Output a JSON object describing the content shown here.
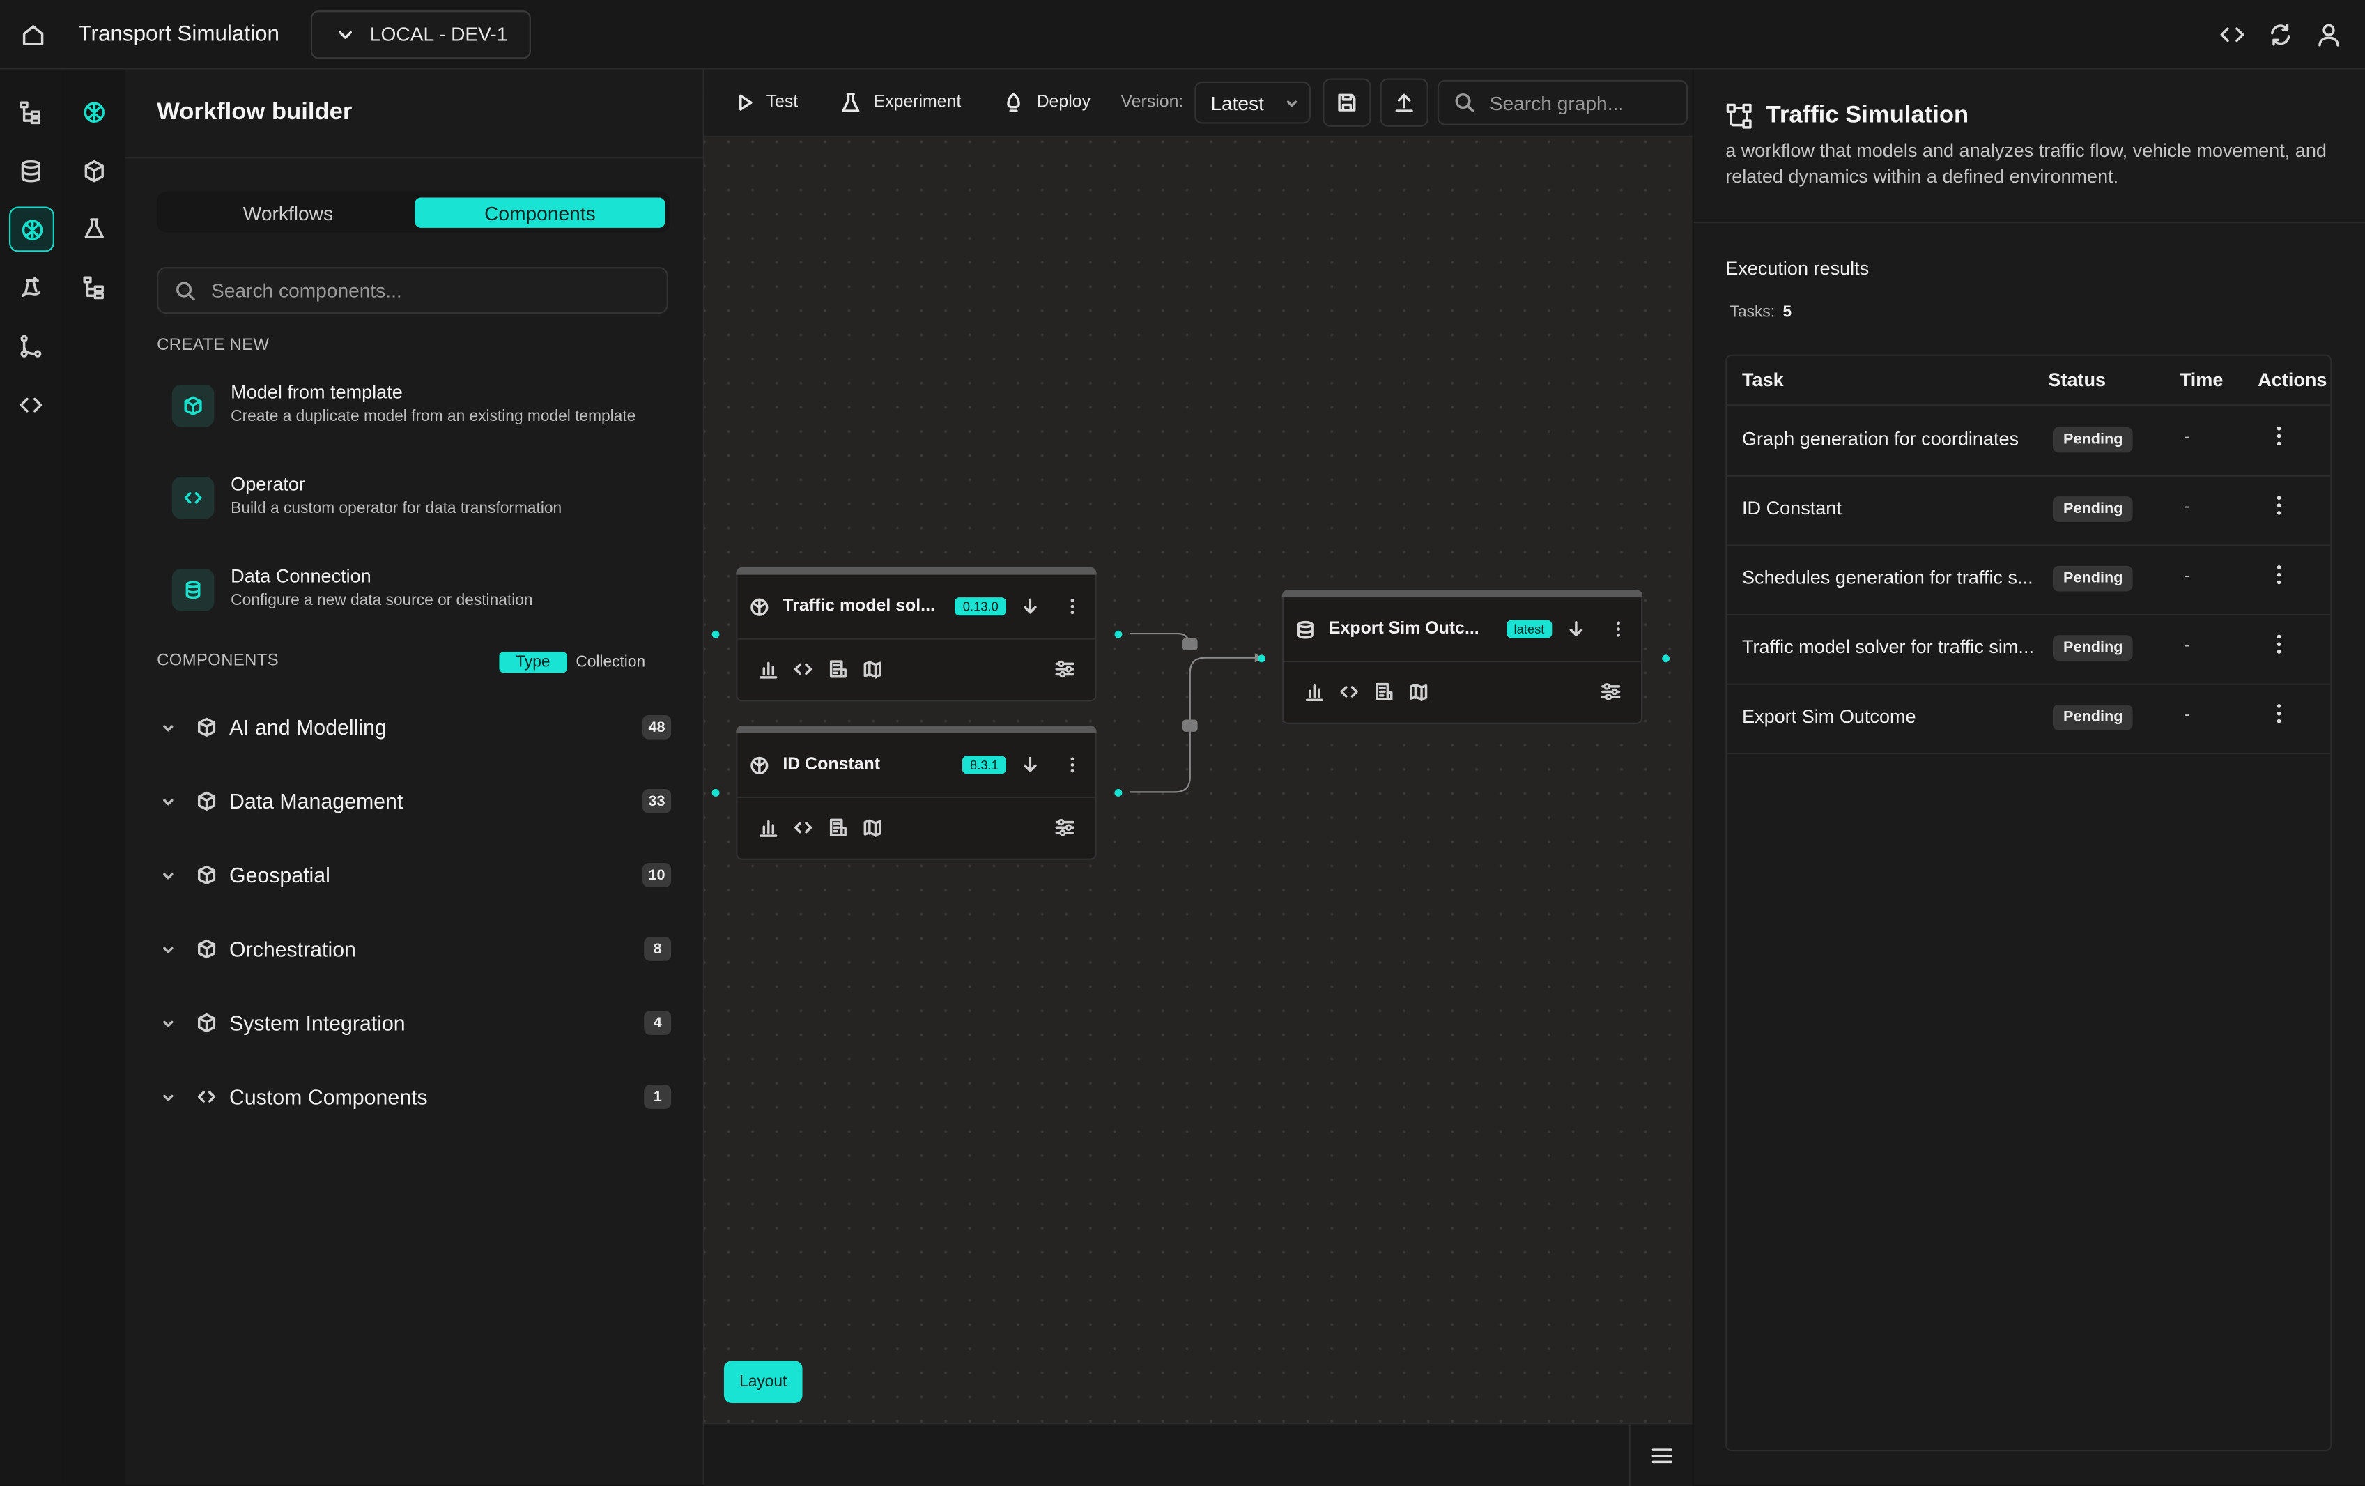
{
  "app": {
    "title": "Transport Simulation",
    "environment": "LOCAL - DEV-1"
  },
  "left_panel": {
    "title": "Workflow builder",
    "tabs": [
      "Workflows",
      "Components"
    ],
    "active_tab": "Components",
    "search_placeholder": "Search components...",
    "create_new_label": "CREATE NEW",
    "create_items": [
      {
        "title": "Model from template",
        "desc": "Create a duplicate model from an existing model template",
        "icon": "cube-icon"
      },
      {
        "title": "Operator",
        "desc": "Build a custom operator for data transformation",
        "icon": "code-icon"
      },
      {
        "title": "Data Connection",
        "desc": "Configure a new data source or destination",
        "icon": "database-icon"
      }
    ],
    "components_label": "COMPONENTS",
    "view_toggle": [
      "Type",
      "Collection"
    ],
    "active_view": "Type",
    "categories": [
      {
        "label": "AI and Modelling",
        "count": "48"
      },
      {
        "label": "Data Management",
        "count": "33"
      },
      {
        "label": "Geospatial",
        "count": "10"
      },
      {
        "label": "Orchestration",
        "count": "8"
      },
      {
        "label": "System Integration",
        "count": "4"
      },
      {
        "label": "Custom Components",
        "count": "1"
      }
    ]
  },
  "toolbar": {
    "test": "Test",
    "experiment": "Experiment",
    "deploy": "Deploy",
    "version_label": "Version:",
    "version_value": "Latest",
    "search_placeholder": "Search graph..."
  },
  "nodes": [
    {
      "title": "Traffic model sol...",
      "version": "0.13.0",
      "icon": "brain-icon"
    },
    {
      "title": "ID Constant",
      "version": "8.3.1",
      "icon": "brain-icon"
    },
    {
      "title": "Export Sim Outc...",
      "version": "latest",
      "icon": "database-icon"
    }
  ],
  "canvas": {
    "layout_button": "Layout"
  },
  "right_panel": {
    "title": "Traffic Simulation",
    "description": "a workflow that models and analyzes traffic flow, vehicle movement, and related dynamics within a defined environment.",
    "execution_heading": "Execution results",
    "tasks_label": "Tasks:",
    "tasks_count": "5",
    "columns": [
      "Task",
      "Status",
      "Time",
      "Actions"
    ],
    "rows": [
      {
        "task": "Graph generation for coordinates",
        "status": "Pending",
        "time": "-"
      },
      {
        "task": "ID Constant",
        "status": "Pending",
        "time": "-"
      },
      {
        "task": "Schedules generation for traffic s...",
        "status": "Pending",
        "time": "-"
      },
      {
        "task": "Traffic model solver for traffic sim...",
        "status": "Pending",
        "time": "-"
      },
      {
        "task": "Export Sim Outcome",
        "status": "Pending",
        "time": "-"
      }
    ]
  },
  "colors": {
    "accent": "#19e4d3",
    "background": "#141414",
    "panel": "#1b1b1b",
    "canvas": "#252423"
  }
}
